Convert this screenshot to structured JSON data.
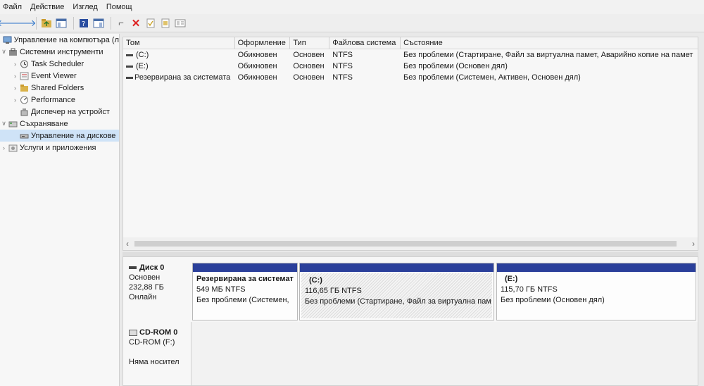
{
  "menu": [
    "Файл",
    "Действие",
    "Изглед",
    "Помощ"
  ],
  "toolbar_icons": [
    "back-arrow-icon",
    "forward-arrow-icon",
    "up-folder-icon",
    "show-tree-icon",
    "help-icon",
    "console-icon",
    "connect-icon",
    "delete-icon",
    "check-icon",
    "folder-icon",
    "properties-icon"
  ],
  "tree": {
    "items": [
      {
        "label": "Управление на компютъра (л",
        "icon": "computer-management-icon",
        "arrow": ""
      },
      {
        "label": "Системни инструменти",
        "icon": "tools-icon",
        "arrow": "∨"
      },
      {
        "label": "Task Scheduler",
        "icon": "clock-icon",
        "arrow": "›"
      },
      {
        "label": "Event Viewer",
        "icon": "event-viewer-icon",
        "arrow": "›"
      },
      {
        "label": "Shared Folders",
        "icon": "shared-folders-icon",
        "arrow": "›"
      },
      {
        "label": "Performance",
        "icon": "performance-icon",
        "arrow": "›"
      },
      {
        "label": "Диспечер на устройст",
        "icon": "device-manager-icon",
        "arrow": ""
      },
      {
        "label": "Съхраняване",
        "icon": "storage-icon",
        "arrow": "∨"
      },
      {
        "label": "Управление на дискове",
        "icon": "disk-management-icon",
        "arrow": ""
      },
      {
        "label": "Услуги и приложения",
        "icon": "services-icon",
        "arrow": "›"
      }
    ]
  },
  "volumes": {
    "headers": [
      "Том",
      "Оформление",
      "Тип",
      "Файлова система",
      "Състояние"
    ],
    "rows": [
      [
        "(C:)",
        "Обикновен",
        "Основен",
        "NTFS",
        "Без проблеми (Стартиране, Файл за виртуална памет, Аварийно копие на памет"
      ],
      [
        "(E:)",
        "Обикновен",
        "Основен",
        "NTFS",
        "Без проблеми (Основен дял)"
      ],
      [
        "Резервирана за системата",
        "Обикновен",
        "Основен",
        "NTFS",
        "Без проблеми (Системен, Активен, Основен дял)"
      ]
    ]
  },
  "disk0": {
    "name": "Диск 0",
    "type": "Основен",
    "size": "232,88 ГБ",
    "status": "Онлайн",
    "partitions": [
      {
        "name": "Резервирана за системат",
        "size": "549 МБ NTFS",
        "status": "Без проблеми (Системен,"
      },
      {
        "name": "(C:)",
        "size": "116,65 ГБ NTFS",
        "status": "Без проблеми (Стартиране, Файл за виртуална пам"
      },
      {
        "name": "(E:)",
        "size": "115,70 ГБ NTFS",
        "status": "Без проблеми (Основен дял)"
      }
    ]
  },
  "cdrom0": {
    "name": "CD-ROM 0",
    "drive": "CD-ROM (F:)",
    "status": "Няма носител"
  },
  "colors": {
    "partition_bar": "#2a3f9a",
    "selection": "#cfe3f7"
  }
}
